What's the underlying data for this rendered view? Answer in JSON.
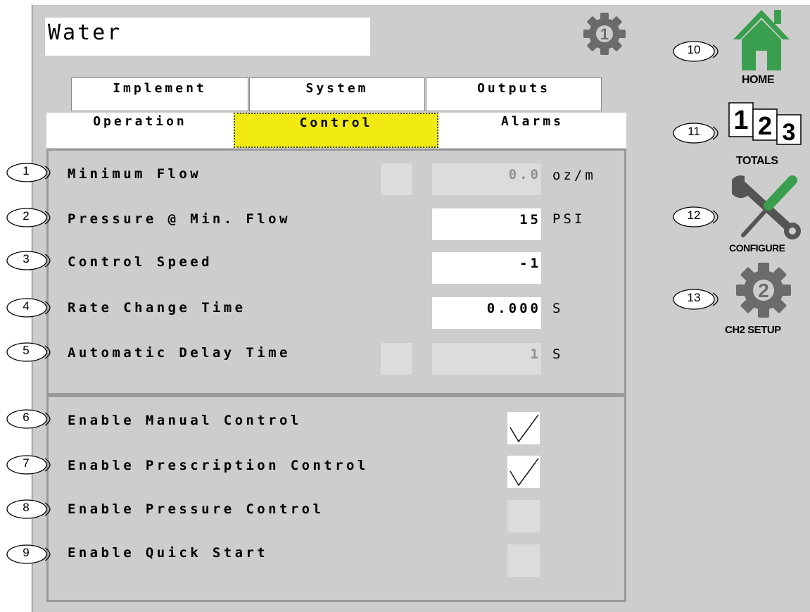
{
  "header": {
    "title": "Water"
  },
  "tabs_row1": [
    {
      "label": "Implement"
    },
    {
      "label": "System"
    },
    {
      "label": "Outputs"
    }
  ],
  "tabs_row2": [
    {
      "label": "Operation",
      "active": false
    },
    {
      "label": "Control",
      "active": true
    },
    {
      "label": "Alarms",
      "active": false
    }
  ],
  "settings": [
    {
      "callout": "1",
      "label": "Minimum Flow",
      "value": "0.0",
      "unit": "oz/m",
      "editable": false
    },
    {
      "callout": "2",
      "label": "Pressure @ Min. Flow",
      "value": "15",
      "unit": "PSI",
      "editable": true
    },
    {
      "callout": "3",
      "label": "Control Speed",
      "value": "-1",
      "unit": "",
      "editable": true
    },
    {
      "callout": "4",
      "label": "Rate Change Time",
      "value": "0.000",
      "unit": "S",
      "editable": true
    },
    {
      "callout": "5",
      "label": "Automatic Delay Time",
      "value": "1",
      "unit": "S",
      "editable": false
    }
  ],
  "toggles": [
    {
      "callout": "6",
      "label": "Enable Manual Control",
      "checked": true
    },
    {
      "callout": "7",
      "label": "Enable Prescription Control",
      "checked": true
    },
    {
      "callout": "8",
      "label": "Enable Pressure Control",
      "checked": false
    },
    {
      "callout": "9",
      "label": "Enable Quick Start",
      "checked": false
    }
  ],
  "nav": [
    {
      "callout": "10",
      "label": "HOME",
      "icon": "home-icon"
    },
    {
      "callout": "11",
      "label": "TOTALS",
      "icon": "totals-icon",
      "digits": [
        "1",
        "2",
        "3"
      ]
    },
    {
      "callout": "12",
      "label": "CONFIGURE",
      "icon": "wrench-screwdriver-icon"
    },
    {
      "callout": "13",
      "label": "CH2 SETUP",
      "icon": "gear-2-icon",
      "badge": "2"
    }
  ],
  "top_gear_badge": "1",
  "colors": {
    "active_tab": "#f1ea13",
    "home_green": "#3a9e4f",
    "gear_gray": "#6b6b6b",
    "background": "#cdcdcd"
  }
}
